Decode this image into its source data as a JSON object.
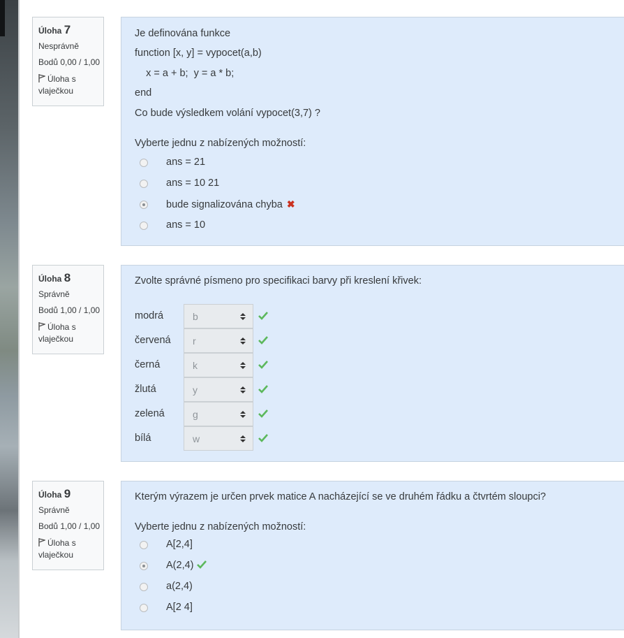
{
  "questions": [
    {
      "label": "Úloha",
      "number": "7",
      "state": "Nesprávně",
      "grade": "Bodů 0,00 / 1,00",
      "flag_label": "Úloha s vlaječkou",
      "text_lines": [
        "Je definována funkce",
        "function [x, y] = vypocet(a,b)",
        "    x = a + b;  y = a * b;",
        "end",
        "Co bude výsledkem volání vypocet(3,7) ?"
      ],
      "prompt": "Vyberte jednu z nabízených možností:",
      "answers": [
        {
          "label": "ans = 21",
          "checked": false,
          "feedback": ""
        },
        {
          "label": "ans = 10 21",
          "checked": false,
          "feedback": ""
        },
        {
          "label": "bude signalizována chyba",
          "checked": true,
          "feedback": "✖"
        },
        {
          "label": "ans = 10",
          "checked": false,
          "feedback": ""
        }
      ]
    },
    {
      "label": "Úloha",
      "number": "8",
      "state": "Správně",
      "grade": "Bodů 1,00 / 1,00",
      "flag_label": "Úloha s vlaječkou",
      "text": "Zvolte správné písmeno pro specifikaci barvy při kreslení křivek:",
      "matches": [
        {
          "label": "modrá",
          "value": "b"
        },
        {
          "label": "červená",
          "value": "r"
        },
        {
          "label": "černá",
          "value": "k"
        },
        {
          "label": "žlutá",
          "value": "y"
        },
        {
          "label": "zelená",
          "value": "g"
        },
        {
          "label": "bílá",
          "value": "w"
        }
      ]
    },
    {
      "label": "Úloha",
      "number": "9",
      "state": "Správně",
      "grade": "Bodů 1,00 / 1,00",
      "flag_label": "Úloha s vlaječkou",
      "text": "Kterým výrazem je určen prvek matice A nacházející se ve druhém řádku a čtvrtém sloupci?",
      "prompt": "Vyberte jednu z nabízených možností:",
      "answers": [
        {
          "label": "A[2,4]",
          "checked": false
        },
        {
          "label": "A(2,4)",
          "checked": true
        },
        {
          "label": "a(2,4)",
          "checked": false
        },
        {
          "label": "A[2 4]",
          "checked": false
        }
      ]
    }
  ],
  "colors": {
    "info_bg": "#f8f9fa",
    "content_bg": "#deebfb",
    "correct": "#5cb85c",
    "incorrect": "#ca3120"
  },
  "icons": {
    "flag": "flag-icon",
    "correct": "check-icon",
    "incorrect": "cross-icon",
    "select_arrows": "select-arrows-icon"
  }
}
